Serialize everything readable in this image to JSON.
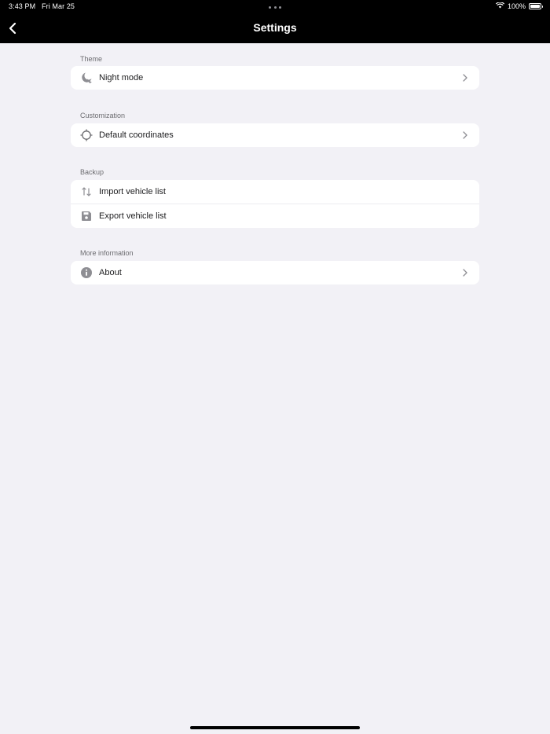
{
  "status_bar": {
    "time": "3:43 PM",
    "date": "Fri Mar 25",
    "battery": "100%"
  },
  "nav": {
    "title": "Settings",
    "back_icon": "chevron-left-icon"
  },
  "sections": [
    {
      "label": "Theme",
      "items": [
        {
          "label": "Night mode",
          "icon": "moon-icon",
          "chevron": true
        }
      ]
    },
    {
      "label": "Customization",
      "items": [
        {
          "label": "Default coordinates",
          "icon": "crosshair-icon",
          "chevron": true
        }
      ]
    },
    {
      "label": "Backup",
      "items": [
        {
          "label": "Import vehicle list",
          "icon": "import-arrows-icon",
          "chevron": false
        },
        {
          "label": "Export vehicle list",
          "icon": "save-disk-icon",
          "chevron": false
        }
      ]
    },
    {
      "label": "More information",
      "items": [
        {
          "label": "About",
          "icon": "info-icon",
          "chevron": true
        }
      ]
    }
  ],
  "colors": {
    "background": "#f2f1f6",
    "nav_background": "#000000",
    "icon_gray": "#8e8e93"
  }
}
